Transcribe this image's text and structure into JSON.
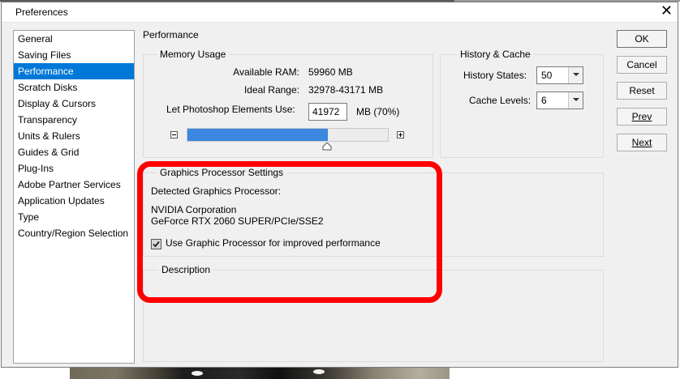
{
  "window": {
    "title": "Preferences",
    "close_label": "✕"
  },
  "sidebar": {
    "items": [
      {
        "label": "General"
      },
      {
        "label": "Saving Files"
      },
      {
        "label": "Performance",
        "selected": true
      },
      {
        "label": "Scratch Disks"
      },
      {
        "label": "Display & Cursors"
      },
      {
        "label": "Transparency"
      },
      {
        "label": "Units & Rulers"
      },
      {
        "label": "Guides & Grid"
      },
      {
        "label": "Plug-Ins"
      },
      {
        "label": "Adobe Partner Services"
      },
      {
        "label": "Application Updates"
      },
      {
        "label": "Type"
      },
      {
        "label": "Country/Region Selection"
      }
    ]
  },
  "panel": {
    "title": "Performance",
    "memory": {
      "group_label": "Memory Usage",
      "available_label": "Available RAM:",
      "available_value": "59960 MB",
      "ideal_label": "Ideal Range:",
      "ideal_value": "32978-43171 MB",
      "use_label": "Let Photoshop Elements Use:",
      "use_value": "41972",
      "use_unit": "MB (70%)",
      "slider_fraction": 0.7
    },
    "history": {
      "group_label": "History & Cache",
      "states_label": "History States:",
      "states_value": "50",
      "cache_label": "Cache Levels:",
      "cache_value": "6"
    },
    "gpu": {
      "group_label": "Graphics Processor Settings",
      "detected_label": "Detected Graphics Processor:",
      "vendor": "NVIDIA Corporation",
      "renderer": "GeForce RTX 2060 SUPER/PCIe/SSE2",
      "checkbox_label": "Use Graphic Processor for improved performance",
      "checked": true
    },
    "description": {
      "group_label": "Description"
    }
  },
  "buttons": {
    "ok": "OK",
    "cancel": "Cancel",
    "reset": "Reset",
    "prev": "Prev",
    "next": "Next"
  },
  "colors": {
    "selection": "#0078d7",
    "slider_fill": "#3c87e0",
    "highlight": "#ff0000"
  }
}
